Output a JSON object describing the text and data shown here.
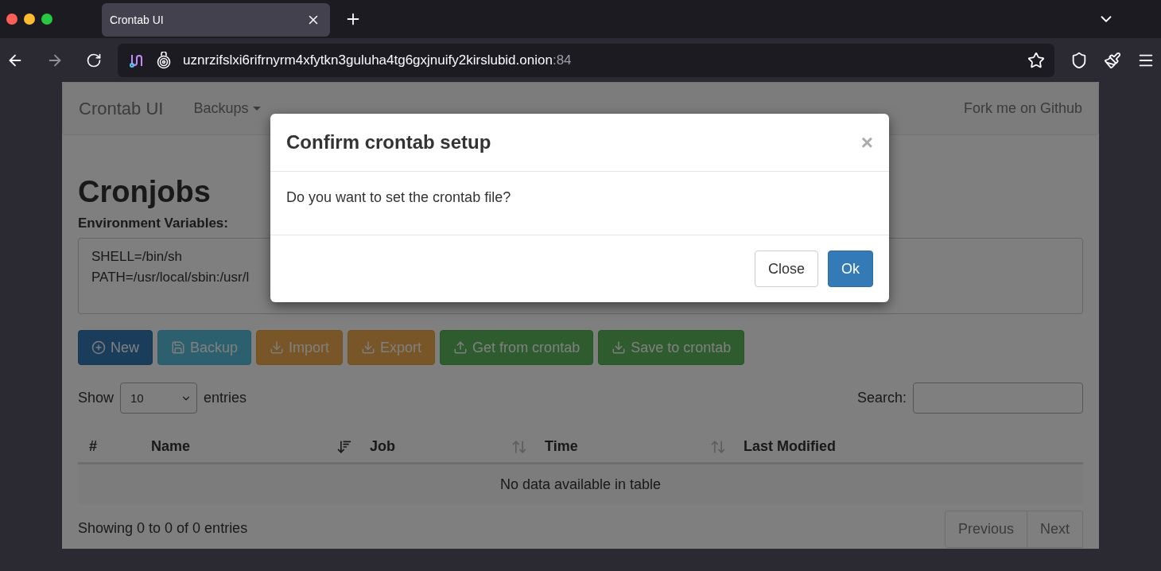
{
  "browser": {
    "tabs": [
      {
        "label": "Crontab UI",
        "selected": true
      }
    ],
    "address": {
      "host": "uznrzifslxi6rifrnyrm4xfytkn3guluha4tg6gxjnuify2kirslubid.onion",
      "port": ":84"
    }
  },
  "navbar": {
    "brand": "Crontab UI",
    "menu": [
      {
        "label": "Backups",
        "kind": "dropdown"
      }
    ],
    "right_link": "Fork me on Github"
  },
  "page": {
    "heading": "Cronjobs",
    "env_label": "Environment Variables:",
    "env_lines": [
      "SHELL=/bin/sh",
      "PATH=/usr/local/sbin:/usr/l"
    ],
    "toolbar": [
      {
        "label": "New",
        "kind": "primary"
      },
      {
        "label": "Backup",
        "kind": "info"
      },
      {
        "label": "Import",
        "kind": "warning"
      },
      {
        "label": "Export",
        "kind": "warning"
      },
      {
        "label": "Get from crontab",
        "kind": "success"
      },
      {
        "label": "Save to crontab",
        "kind": "success"
      }
    ],
    "length": {
      "before": "Show",
      "value": "10",
      "after": "entries"
    },
    "search": {
      "label": "Search:"
    },
    "table": {
      "columns": [
        {
          "label": "#",
          "sortable": false
        },
        {
          "label": "Name",
          "sortable": true,
          "sorted": true
        },
        {
          "label": "Job",
          "sortable": true,
          "sorted": false
        },
        {
          "label": "Time",
          "sortable": true,
          "sorted": false
        },
        {
          "label": "Last Modified",
          "sortable": false
        }
      ],
      "empty": "No data available in table"
    },
    "info": "Showing 0 to 0 of 0 entries",
    "pager": [
      "Previous",
      "Next"
    ]
  },
  "modal": {
    "title": "Confirm crontab setup",
    "close": "×",
    "body": "Do you want to set the crontab file?",
    "buttons": [
      {
        "label": "Close",
        "kind": "default"
      },
      {
        "label": "Ok",
        "kind": "primary"
      }
    ]
  }
}
